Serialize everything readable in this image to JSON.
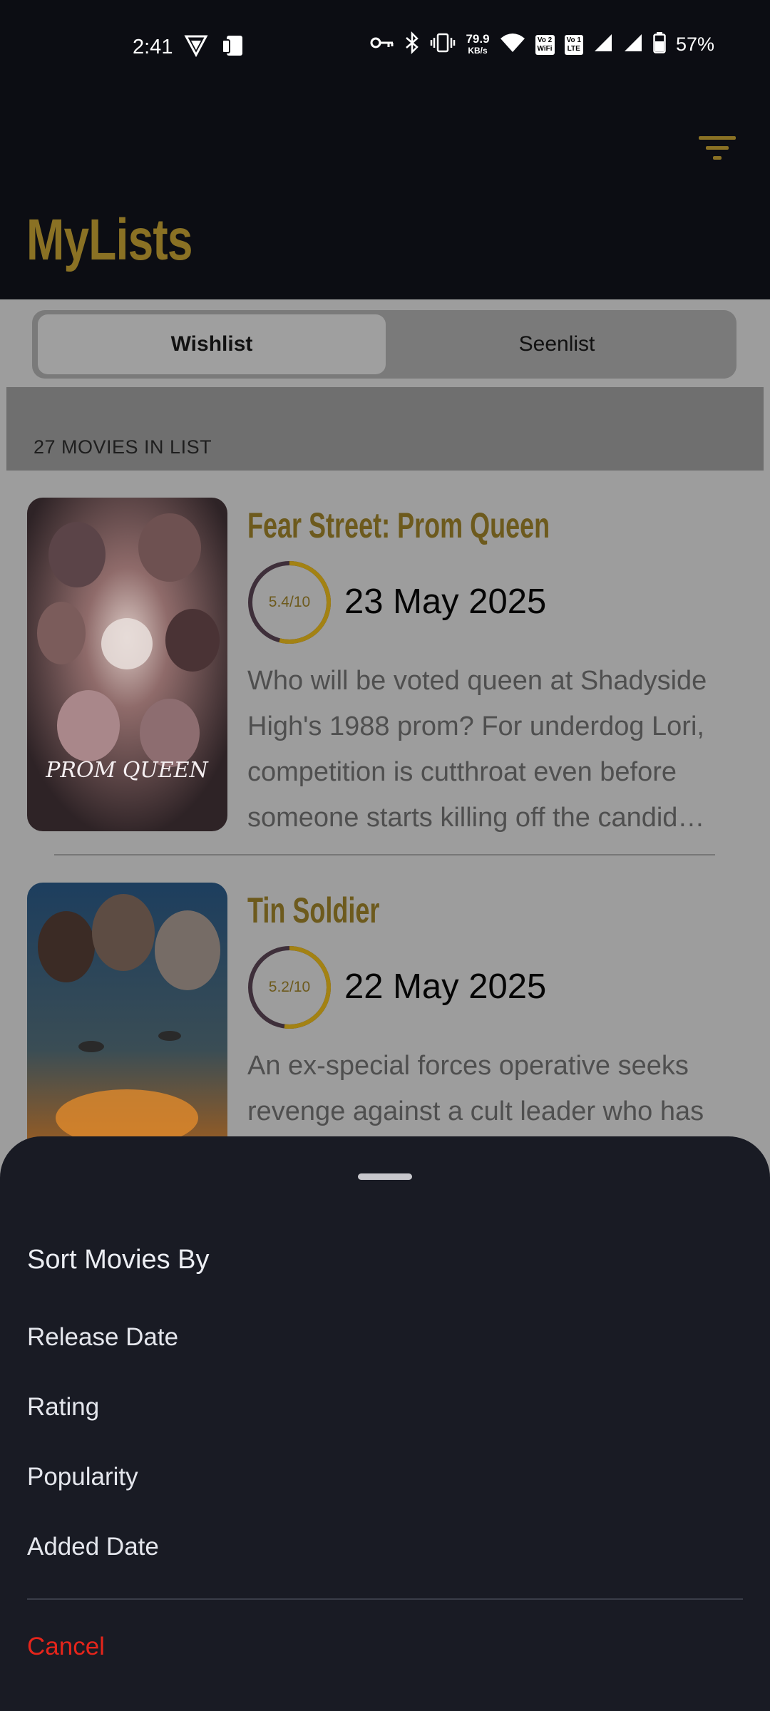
{
  "status_bar": {
    "time": "2:41",
    "net_speed": "79.9",
    "net_speed_unit": "KB/s",
    "sim1": "Vo 2 WiFi",
    "sim2": "Vo 1 LTE",
    "battery": "57%"
  },
  "header": {
    "title": "MyLists",
    "filter_icon": "filter-icon",
    "accent_color": "#8a7124"
  },
  "tabs": [
    {
      "label": "Wishlist",
      "active": true
    },
    {
      "label": "Seenlist",
      "active": false
    }
  ],
  "list": {
    "count_label": "27 MOVIES IN LIST",
    "movies": [
      {
        "title": "Fear Street: Prom Queen",
        "rating": "5.4/10",
        "rating_value": 5.4,
        "date": "23 May 2025",
        "description": "Who will be voted queen at Shadyside High's 1988 prom? For underdog Lori, competition is cutthroat even before someone starts killing off the candid…",
        "poster_text": "PROM QUEEN"
      },
      {
        "title": "Tin Soldier",
        "rating": "5.2/10",
        "rating_value": 5.2,
        "date": "22 May 2025",
        "description": "An ex-special forces operative seeks revenge against a cult leader who has"
      }
    ]
  },
  "sort_sheet": {
    "title": "Sort Movies By",
    "options": [
      "Release Date",
      "Rating",
      "Popularity",
      "Added Date"
    ],
    "cancel": "Cancel",
    "cancel_color": "#e5251b"
  }
}
